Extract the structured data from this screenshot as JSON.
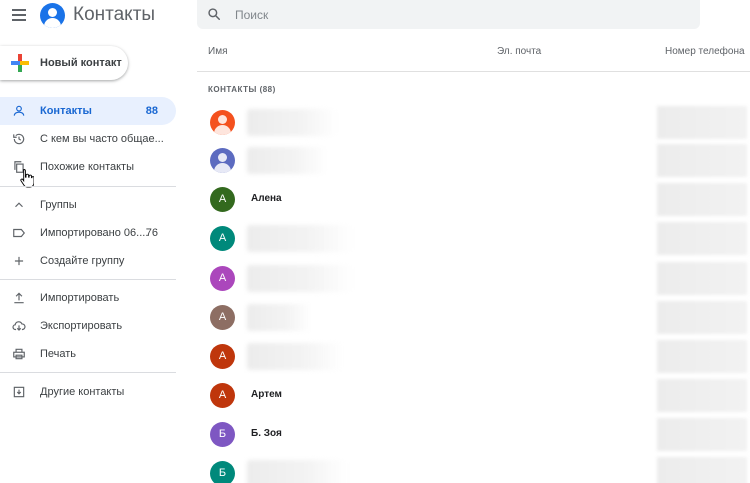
{
  "app": {
    "title": "Контакты"
  },
  "search": {
    "placeholder": "Поиск"
  },
  "new_contact": {
    "label": "Новый контакт"
  },
  "sidebar": {
    "items": [
      {
        "label": "Контакты",
        "count": "88",
        "icon": "person-icon",
        "active": true
      },
      {
        "label": "С кем вы часто общае...",
        "icon": "history-icon"
      },
      {
        "label": "Похожие контакты",
        "icon": "copy-icon"
      },
      {
        "label": "Группы",
        "icon": "chevron-up-icon"
      },
      {
        "label": "Импортировано 06....",
        "count": "76",
        "icon": "label-icon"
      },
      {
        "label": "Создайте группу",
        "icon": "plus-icon"
      },
      {
        "label": "Импортировать",
        "icon": "upload-icon"
      },
      {
        "label": "Экспортировать",
        "icon": "cloud-download-icon"
      },
      {
        "label": "Печать",
        "icon": "print-icon"
      },
      {
        "label": "Другие контакты",
        "icon": "archive-icon"
      }
    ]
  },
  "table": {
    "columns": {
      "name": "Имя",
      "email": "Эл. почта",
      "phone": "Номер телефона"
    },
    "section_label": "КОНТАКТЫ (88)",
    "rows": [
      {
        "initial": "",
        "name": "",
        "color": "#f4511e",
        "photo": true
      },
      {
        "initial": "",
        "name": "",
        "color": "#5c6bc0",
        "photo": true
      },
      {
        "initial": "А",
        "name": "Алена",
        "color": "#33691e"
      },
      {
        "initial": "А",
        "name": "",
        "color": "#00897b"
      },
      {
        "initial": "А",
        "name": "",
        "color": "#ab47bc"
      },
      {
        "initial": "А",
        "name": "",
        "color": "#8d6e63"
      },
      {
        "initial": "А",
        "name": "",
        "color": "#bf360c"
      },
      {
        "initial": "А",
        "name": "Артем",
        "color": "#bf360c"
      },
      {
        "initial": "Б",
        "name": "Б. Зоя",
        "color": "#7e57c2"
      },
      {
        "initial": "Б",
        "name": "",
        "color": "#00897b"
      }
    ]
  }
}
